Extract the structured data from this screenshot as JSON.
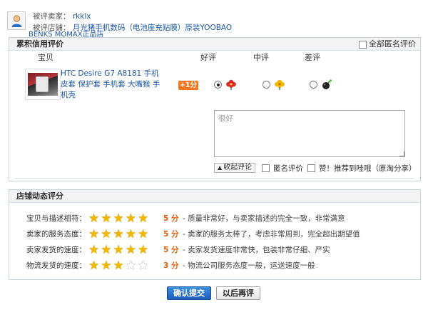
{
  "seller": {
    "seller_label": "被评卖家：",
    "seller_name": "rkklx",
    "shop_label": "被评店铺：",
    "shop_name_line1": "月光猪手机数码（电池座充贴膜）原装YOOBAO",
    "shop_name_line2": "BENKS MOMAX正品店"
  },
  "credit": {
    "title": "累积信用评价",
    "anonymous_all_label": "全部匿名评价",
    "columns": {
      "item": "宝贝",
      "good": "好评",
      "neutral": "中评",
      "bad": "差评"
    },
    "item": {
      "name": "HTC Desire G7 A8181 手机皮套 保护套 手机套 大嘴猴 手机壳",
      "points_badge": "+1分"
    },
    "rating": {
      "selected": "good"
    },
    "comment_placeholder": "很好",
    "collapse_label": "收起评论",
    "anonymous_label": "匿名评价",
    "recommend_label": "赞！推荐到哇哦（原淘分享）"
  },
  "dsr": {
    "title": "店铺动态评分",
    "rows": [
      {
        "label": "宝贝与描述相符：",
        "score": 5,
        "score_label": "5 分",
        "desc": "- 质量非常好，与卖家描述的完全一致，非常满意"
      },
      {
        "label": "卖家的服务态度：",
        "score": 5,
        "score_label": "5 分",
        "desc": "- 卖家的服务太棒了，考虑非常周到，完全超出期望值"
      },
      {
        "label": "卖家发货的速度：",
        "score": 5,
        "score_label": "5 分",
        "desc": "- 卖家发货速度非常快，包装非常仔细、严实"
      },
      {
        "label": "物流发货的速度：",
        "score": 3,
        "score_label": "3 分",
        "desc": "- 物流公司服务态度一般，运送速度一般"
      }
    ]
  },
  "actions": {
    "submit": "确认提交",
    "later": "以后再评"
  },
  "colors": {
    "accent": "#1d57a8",
    "badge": "#f07820",
    "score": "#e0610a",
    "star": "#f2b600"
  }
}
